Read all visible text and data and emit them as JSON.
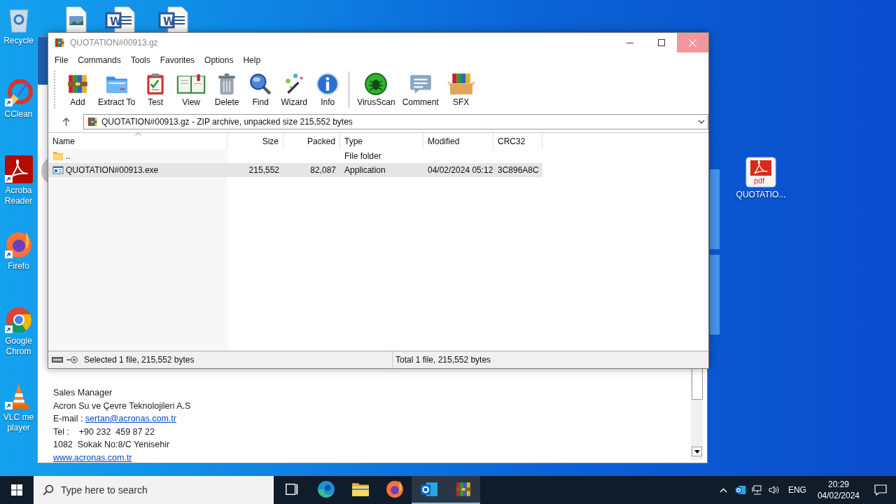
{
  "desktop": {
    "left_icons": [
      {
        "kind": "recycle",
        "lines": [
          "Recycle"
        ]
      },
      {
        "kind": "ccleaner",
        "lines": [
          "CClean"
        ]
      },
      {
        "kind": "acrobat",
        "lines": [
          "Acroba",
          "Reader"
        ]
      },
      {
        "kind": "firefox",
        "lines": [
          "Firefo"
        ]
      },
      {
        "kind": "chrome",
        "lines": [
          "Google",
          "Chrom"
        ]
      },
      {
        "kind": "vlc",
        "lines": [
          "VLC me",
          "player"
        ]
      }
    ],
    "top_icons": [
      {
        "kind": "image"
      },
      {
        "kind": "word",
        "badge": "W"
      },
      {
        "kind": "word",
        "badge": "W"
      }
    ],
    "right_icons": [
      {
        "kind": "pdf",
        "badge": "pdf",
        "lines": [
          "QUOTATIO..."
        ]
      }
    ]
  },
  "email_window": {
    "lines": [
      {
        "kind": "text",
        "text": "Sales Manager"
      },
      {
        "kind": "text",
        "text": "Acron Su ve Çevre Teknolojileri A.S"
      },
      {
        "kind": "link",
        "label": "E-mail : ",
        "text": "sertan@acronas.com.tr"
      },
      {
        "kind": "text",
        "text": "Tel :    +90 232  459 87 22"
      },
      {
        "kind": "text",
        "text": "1082  Sokak No:8/C Yenisehir"
      },
      {
        "kind": "link",
        "text": "www.acronas.com.tr"
      }
    ]
  },
  "winrar": {
    "title": "QUOTATION#00913.gz",
    "menu": [
      "File",
      "Commands",
      "Tools",
      "Favorites",
      "Options",
      "Help"
    ],
    "toolbar": [
      {
        "kind": "add",
        "label": "Add",
        "separator_before": false
      },
      {
        "kind": "extract",
        "label": "Extract To",
        "separator_before": false
      },
      {
        "kind": "test",
        "label": "Test",
        "separator_before": false
      },
      {
        "kind": "view",
        "label": "View",
        "separator_before": false
      },
      {
        "kind": "delete",
        "label": "Delete",
        "separator_before": false
      },
      {
        "kind": "find",
        "label": "Find",
        "separator_before": false
      },
      {
        "kind": "wizard",
        "label": "Wizard",
        "separator_before": false
      },
      {
        "kind": "info",
        "label": "Info",
        "separator_before": false
      },
      {
        "kind": "virusscan",
        "label": "VirusScan",
        "separator_before": true
      },
      {
        "kind": "comment",
        "label": "Comment",
        "separator_before": false
      },
      {
        "kind": "sfx",
        "label": "SFX",
        "separator_before": false
      }
    ],
    "address": "QUOTATION#00913.gz - ZIP archive, unpacked size 215,552 bytes",
    "columns": [
      {
        "label": "Name",
        "sorted": true
      },
      {
        "label": "Size",
        "sorted": false
      },
      {
        "label": "Packed",
        "sorted": false
      },
      {
        "label": "Type",
        "sorted": false
      },
      {
        "label": "Modified",
        "sorted": false
      },
      {
        "label": "CRC32",
        "sorted": false
      }
    ],
    "rows": [
      {
        "kind": "folder",
        "name": "..",
        "type": "File folder",
        "selected": false
      },
      {
        "kind": "exe",
        "name": "QUOTATION#00913.exe",
        "size": "215,552",
        "packed": "82,087",
        "type": "Application",
        "modified": "04/02/2024 05:12",
        "crc32": "3C896A8C",
        "selected": true
      }
    ],
    "status": {
      "selected": "Selected 1 file, 215,552 bytes",
      "total": "Total 1 file, 215,552 bytes"
    }
  },
  "taskbar": {
    "search_placeholder": "Type here to search",
    "apps": [
      {
        "kind": "taskview",
        "active": false
      },
      {
        "kind": "edge",
        "active": false
      },
      {
        "kind": "explorer",
        "active": false
      },
      {
        "kind": "firefox",
        "active": false
      },
      {
        "kind": "outlook",
        "active": true
      },
      {
        "kind": "winrar",
        "active": true
      }
    ],
    "language": "ENG",
    "time": "20:29",
    "date": "04/02/2024"
  }
}
